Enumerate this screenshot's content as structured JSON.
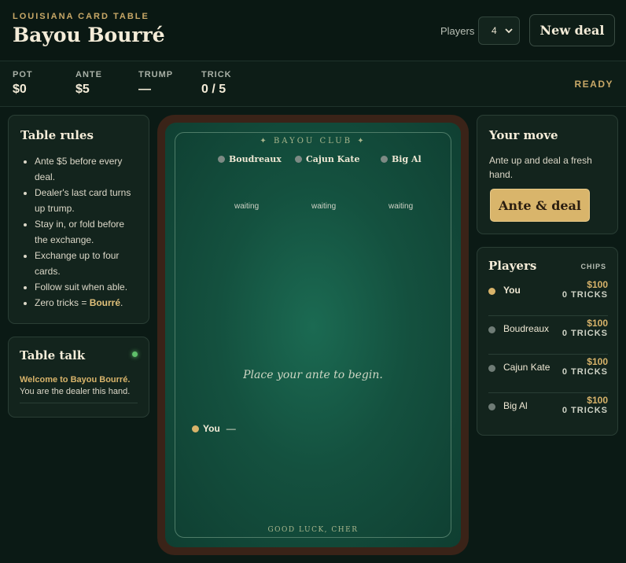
{
  "header": {
    "eyebrow": "LOUISIANA CARD TABLE",
    "title": "Bayou Bourré",
    "players_label": "Players",
    "players_value": "4",
    "new_deal_label": "New deal"
  },
  "stats": [
    {
      "label": "POT",
      "value": "$0"
    },
    {
      "label": "ANTE",
      "value": "$5"
    },
    {
      "label": "TRUMP",
      "value": "—"
    },
    {
      "label": "TRICK",
      "value": "0 / 5"
    }
  ],
  "status": "READY",
  "rules": {
    "title": "Table rules",
    "items": [
      "Ante $5 before every deal.",
      "Dealer's last card turns up trump.",
      "Stay in, or fold before the exchange.",
      "Exchange up to four cards.",
      "Follow suit when able."
    ],
    "last_prefix": "Zero tricks = ",
    "last_highlight": "Bourré",
    "last_suffix": "."
  },
  "talk": {
    "title": "Table talk",
    "welcome": "Welcome to Bayou Bourré.",
    "message": "You are the dealer this hand."
  },
  "table": {
    "club_name": "✦   BAYOU CLUB   ✦",
    "opponents": [
      {
        "name": "Boudreaux",
        "state": "waiting"
      },
      {
        "name": "Cajun Kate",
        "state": "waiting"
      },
      {
        "name": "Big Al",
        "state": "waiting"
      }
    ],
    "prompt": "Place your ante to begin.",
    "you_name": "You",
    "you_status": "—",
    "footer": "GOOD LUCK, CHER"
  },
  "move": {
    "title": "Your move",
    "description": "Ante up and deal a fresh hand.",
    "button_label": "Ante & deal"
  },
  "roster": {
    "title": "Players",
    "chips_header": "CHIPS",
    "players": [
      {
        "name": "You",
        "chips": "$100",
        "tricks": "0 TRICKS"
      },
      {
        "name": "Boudreaux",
        "chips": "$100",
        "tricks": "0 TRICKS"
      },
      {
        "name": "Cajun Kate",
        "chips": "$100",
        "tricks": "0 TRICKS"
      },
      {
        "name": "Big Al",
        "chips": "$100",
        "tricks": "0 TRICKS"
      }
    ]
  },
  "colors": {
    "gold": "#d9b56b",
    "felt": "#14513f",
    "background": "#0b1a15",
    "live_dot": "#5fbf6a"
  }
}
